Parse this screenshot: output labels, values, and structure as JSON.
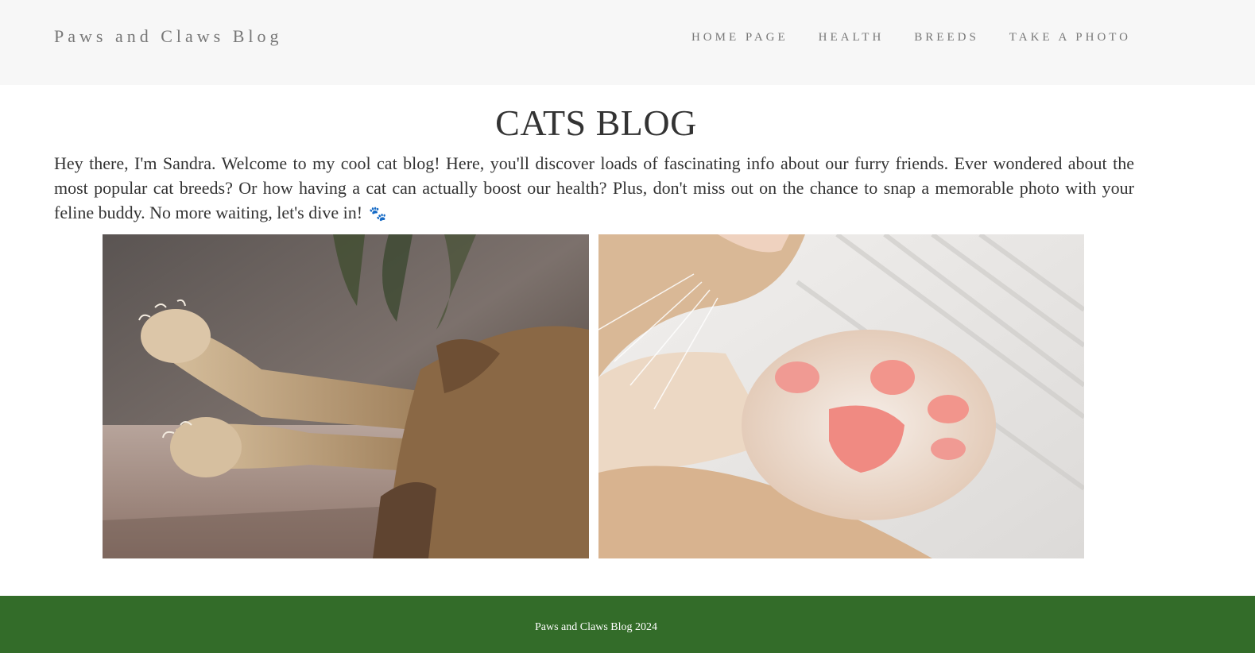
{
  "navbar": {
    "brand": "Paws and Claws Blog",
    "links": [
      {
        "label": "HOME PAGE"
      },
      {
        "label": "HEALTH"
      },
      {
        "label": "BREEDS"
      },
      {
        "label": "TAKE A PHOTO"
      }
    ]
  },
  "main": {
    "title": "CATS BLOG",
    "intro": "Hey there, I'm Sandra. Welcome to my cool cat blog! Here, you'll discover loads of fascinating info about our furry friends. Ever wondered about the most popular cat breeds? Or how having a cat can actually boost our health? Plus, don't miss out on the chance to snap a memorable photo with your feline buddy. No more waiting, let's dive in!",
    "intro_icon": "paw-prints-icon",
    "photos": [
      {
        "subject": "ginger cat stretching paws with claws out"
      },
      {
        "subject": "close-up of pink cat paw pads on white blanket"
      }
    ]
  },
  "footer": {
    "text": "Paws and Claws Blog 2024"
  },
  "colors": {
    "navbar_bg": "#f7f7f7",
    "nav_text": "#777777",
    "body_text": "#333333",
    "footer_bg": "#336c29",
    "footer_text": "#ffffff",
    "paw_icon": "#5b54a8"
  }
}
